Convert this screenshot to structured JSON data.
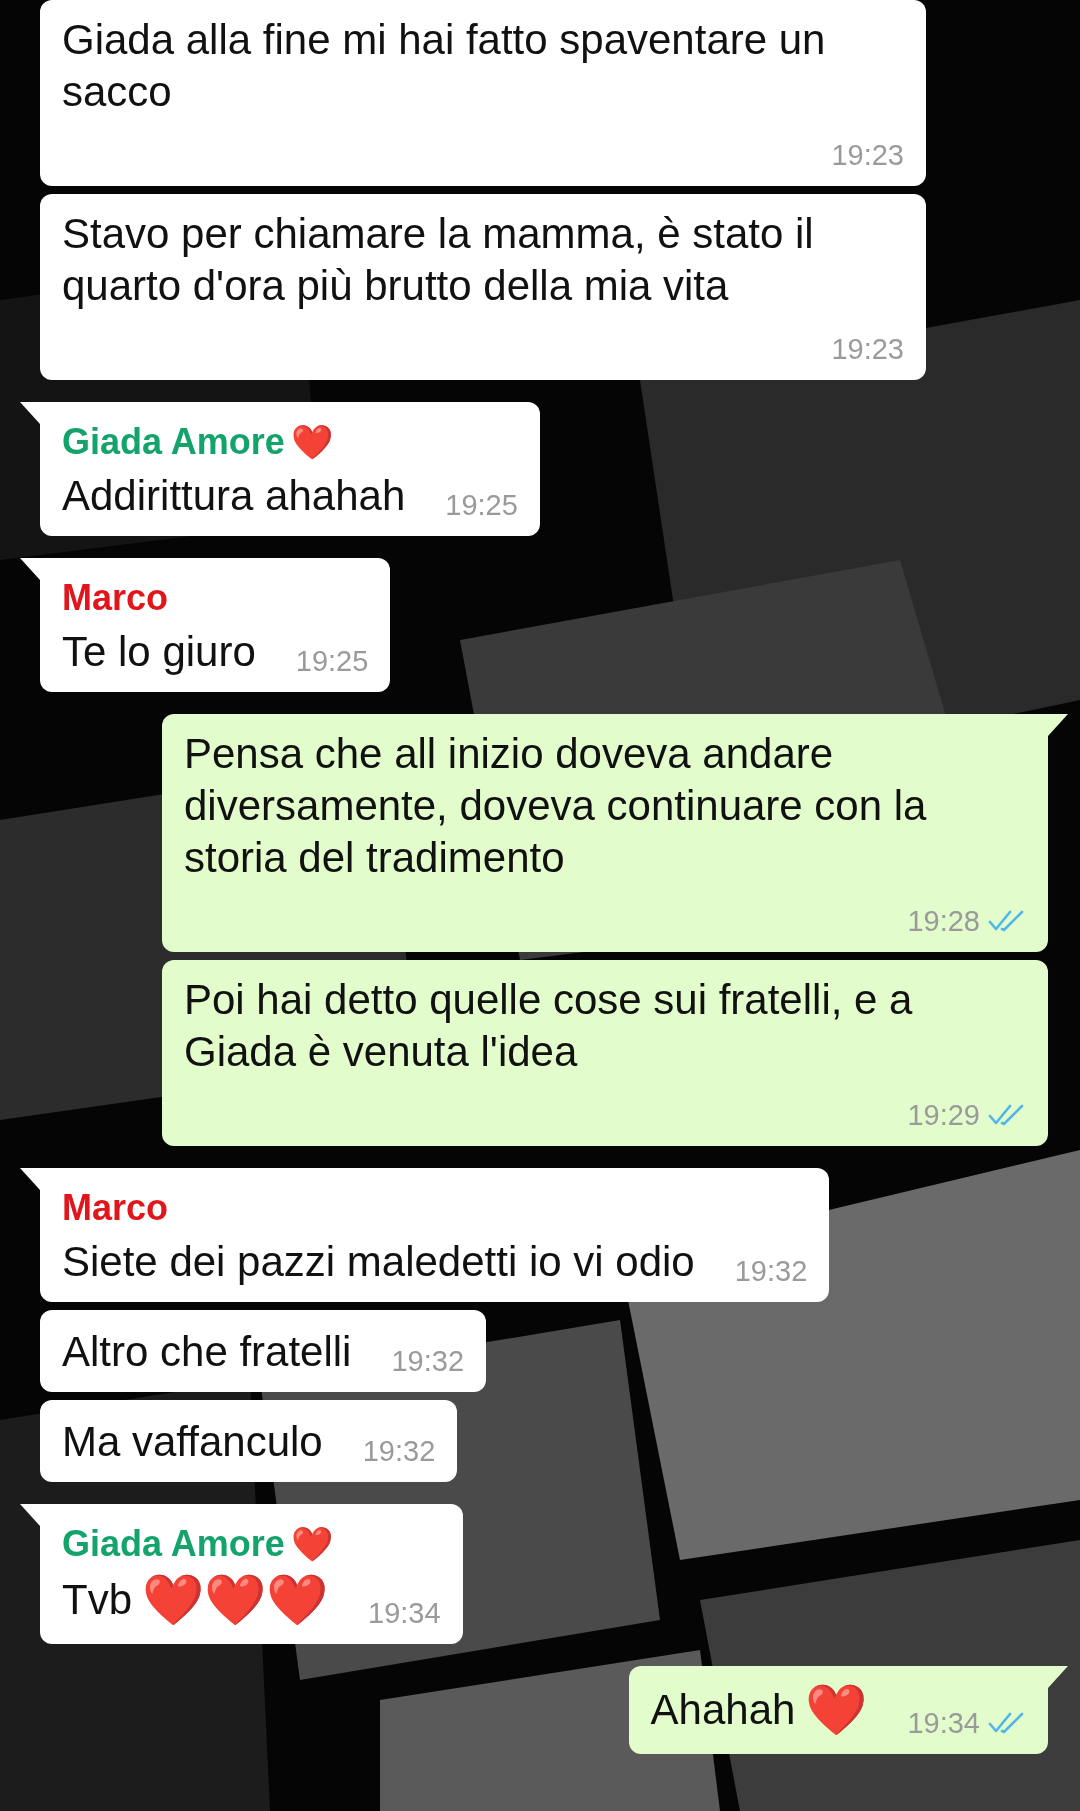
{
  "messages": [
    {
      "kind": "incoming",
      "tail": false,
      "text": "Giada alla fine mi hai fatto spaventare un sacco",
      "time": "19:23"
    },
    {
      "kind": "incoming",
      "tail": false,
      "text": "Stavo per chiamare la mamma, è stato il quarto d'ora più brutto della mia vita",
      "time": "19:23"
    },
    {
      "kind": "incoming",
      "tail": true,
      "sender": {
        "name": "Giada Amore",
        "emoji": "❤️",
        "color": "#13a36b"
      },
      "text": "Addirittura ahahah",
      "time": "19:25"
    },
    {
      "kind": "incoming",
      "tail": true,
      "sender": {
        "name": "Marco",
        "color": "#e0161c"
      },
      "text": "Te lo giuro",
      "time": "19:25"
    },
    {
      "kind": "outgoing",
      "tail": true,
      "text": "Pensa che all inizio doveva andare diversamente, doveva continuare con la storia del tradimento",
      "time": "19:28",
      "read": true
    },
    {
      "kind": "outgoing",
      "tail": false,
      "text": "Poi hai detto quelle cose sui fratelli, e a Giada è venuta l'idea",
      "time": "19:29",
      "read": true
    },
    {
      "kind": "incoming",
      "tail": true,
      "sender": {
        "name": "Marco",
        "color": "#e0161c"
      },
      "text": "Siete dei pazzi maledetti io vi odio",
      "time": "19:32"
    },
    {
      "kind": "incoming",
      "tail": false,
      "text": "Altro che fratelli",
      "time": "19:32"
    },
    {
      "kind": "incoming",
      "tail": false,
      "text": "Ma vaffanculo",
      "time": "19:32"
    },
    {
      "kind": "incoming",
      "tail": true,
      "sender": {
        "name": "Giada Amore",
        "emoji": "❤️",
        "color": "#13a36b"
      },
      "text": "Tvb",
      "emoji": "❤️❤️❤️",
      "time": "19:34"
    },
    {
      "kind": "outgoing",
      "tail": true,
      "text": "Ahahah",
      "emoji": "❤️",
      "time": "19:34",
      "read": true
    }
  ]
}
